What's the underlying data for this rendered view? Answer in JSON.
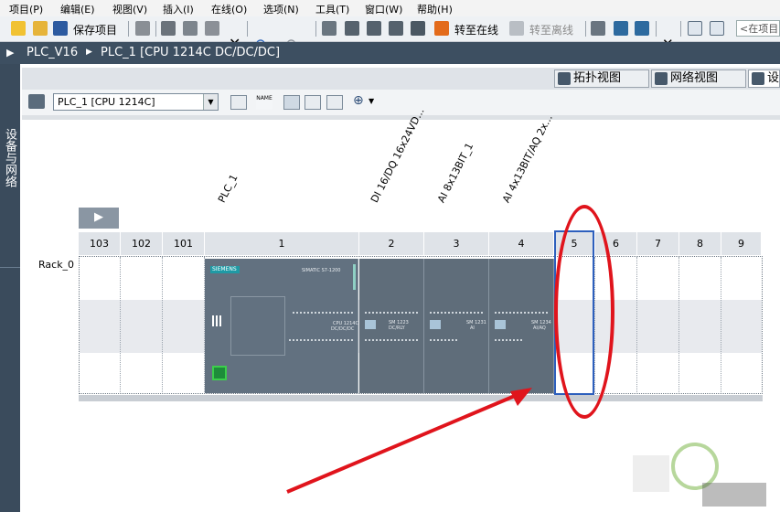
{
  "menu": [
    {
      "label": "项目(P)"
    },
    {
      "label": "编辑(E)"
    },
    {
      "label": "视图(V)"
    },
    {
      "label": "插入(I)"
    },
    {
      "label": "在线(O)"
    },
    {
      "label": "选项(N)"
    },
    {
      "label": "工具(T)"
    },
    {
      "label": "窗口(W)"
    },
    {
      "label": "帮助(H)"
    }
  ],
  "toolbar": {
    "save_project": "保存项目",
    "go_online": "转至在线",
    "go_offline": "转至离线",
    "search_placeholder": "<在项目"
  },
  "breadcrumb": {
    "project": "PLC_V16",
    "device": "PLC_1 [CPU 1214C DC/DC/DC]"
  },
  "side_panel_label": "设备与网络",
  "view_tabs": [
    {
      "label": "拓扑视图"
    },
    {
      "label": "网络视图"
    },
    {
      "label": "设"
    }
  ],
  "device_select": {
    "value": "PLC_1 [CPU 1214C]"
  },
  "module_labels": {
    "plc": "PLC_1",
    "di": "DI 16/DQ 16x24VD...",
    "ai8": "AI 8x13BIT_1",
    "ai4": "AI 4x13BIT/AQ 2x..."
  },
  "rack": {
    "name": "Rack_0",
    "slots": [
      "103",
      "102",
      "101",
      "1",
      "2",
      "3",
      "4",
      "5",
      "6",
      "7",
      "8",
      "9"
    ],
    "highlighted_slot": "5"
  },
  "module_text": {
    "brand": "SIEMENS",
    "cpu_series": "SIMATIC S7-1200",
    "cpu_model": "CPU 1214C",
    "cpu_type": "DC/DC/DC",
    "sm1223": "SM 1223",
    "sm1223_type": "DC/RLY",
    "sm1231": "SM 1231",
    "sm1231_type": "AI",
    "sm1234": "SM 1234",
    "sm1234_type": "AI/AQ"
  },
  "colors": {
    "breadcrumb_bg": "#3d4f61",
    "module_body": "#5f6d7a",
    "slot_highlight": "#2d5fbd",
    "annotation_red": "#e0141c"
  }
}
